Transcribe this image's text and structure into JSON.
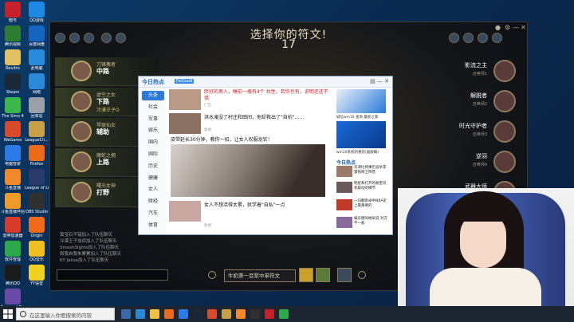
{
  "desktop_icons": [
    {
      "label": "暗号",
      "color": "#c8202a"
    },
    {
      "label": "QQ游戏",
      "color": "#1e88e5"
    },
    {
      "label": "腾讯视频",
      "color": "#2e7d32"
    },
    {
      "label": "百度网盘",
      "color": "#1565c0"
    },
    {
      "label": "Revitro",
      "color": "#e0c060"
    },
    {
      "label": "此电脑",
      "color": "#2a8ad8"
    },
    {
      "label": "Steam",
      "color": "#1b2838"
    },
    {
      "label": "网络",
      "color": "#2a8ad8"
    },
    {
      "label": "The Sims 4",
      "color": "#3ab84a"
    },
    {
      "label": "回收站",
      "color": "#9aa0a8"
    },
    {
      "label": "WeGame",
      "color": "#d84a2a"
    },
    {
      "label": "LeagueCli...",
      "color": "#c8a04a"
    },
    {
      "label": "电脑管家",
      "color": "#2a7ae8"
    },
    {
      "label": "Firefox",
      "color": "#e86a1a"
    },
    {
      "label": "斗鱼直播",
      "color": "#f08a2a"
    },
    {
      "label": "League of Legends",
      "color": "#2a3a6a"
    },
    {
      "label": "斗鱼直播伴侣",
      "color": "#f09a2a"
    },
    {
      "label": "OBS Studio",
      "color": "#303030"
    },
    {
      "label": "雷神加速器",
      "color": "#d83a2a"
    },
    {
      "label": "Origin",
      "color": "#f06a1a"
    },
    {
      "label": "软件管理",
      "color": "#2aa84a"
    },
    {
      "label": "QQ音乐",
      "color": "#f0c020"
    },
    {
      "label": "腾讯QQ",
      "color": "#1a1a1a"
    },
    {
      "label": "YY语音",
      "color": "#f0d020"
    },
    {
      "label": "Funmeal Party",
      "color": "#6a4aa8"
    }
  ],
  "game": {
    "title": "选择你的符文!",
    "timer": "17",
    "left_team": [
      {
        "role": "刀锋舞者",
        "lane": "中路",
        "name": ""
      },
      {
        "role": "虚空之女",
        "lane": "下路",
        "name": "冷漠王子O"
      },
      {
        "role": "琴瑟仙女",
        "lane": "辅助",
        "name": ""
      },
      {
        "role": "魔蛇之拥",
        "lane": "上路",
        "name": ""
      },
      {
        "role": "曙光女神",
        "lane": "打野",
        "name": ""
      }
    ],
    "chat_lines": [
      "黄宝石不错加入了队伍聊天",
      "冷漠王子加佰加入了队伍聊天",
      "SmashSights加入了队伍聊天",
      "和我自我朱累累加入了队伍聊天",
      "KY Jaksa加入了队伍聊天"
    ],
    "right_team": [
      {
        "name": "影流之主",
        "sub": "召唤师1"
      },
      {
        "name": "解脱者",
        "sub": "召唤师2"
      },
      {
        "name": "时光守护者",
        "sub": "召唤师3"
      },
      {
        "name": "逆羽",
        "sub": "召唤师4"
      },
      {
        "name": "武器大师",
        "sub": "召唤师5"
      }
    ],
    "skin_select": "牛奶第一豆浆中单符文",
    "window_controls": [
      "●",
      "⚙",
      "—",
      "✕"
    ]
  },
  "popup": {
    "title": "今日热点",
    "badge": "FeiGuo8",
    "controls": "▤ — ✕",
    "categories": [
      "头条",
      "社会",
      "军事",
      "娱乐",
      "国内",
      "国际",
      "历史",
      "健康",
      "女人",
      "财经",
      "汽车",
      "体育"
    ],
    "active_category": "头条",
    "items": [
      {
        "text": "胖好的男人，睡前一瓶有4个 共性，若你也有，说明还还不错",
        "source": "广告",
        "red": true
      },
      {
        "text": "洪水淹没了村庄和田间，他却救出了\"自杭\"……",
        "source": "新闻"
      },
      {
        "text": "皮带延长30分钟，教你一招，让女人叹服龙钦！",
        "source": ""
      },
      {
        "text": "女人不想活得太累，就学着\"自私\"一点",
        "source": "新闻"
      }
    ],
    "side": {
      "ad_title": "城信win10 查询 最新之家",
      "ad2_title": "win10系统的重装(副服确)",
      "hot_title": "今日热点",
      "hot_items": [
        "天津比特事仍追杀李雷抱保卫阵营",
        "明星和打开的秘密玩机拨动的细节",
        "一归翻街卓中NBA史上最重要的",
        "娱乐圈叫她早说 对方不一般"
      ]
    }
  },
  "taskbar": {
    "search_placeholder": "在这里输入你要搜索的内容"
  }
}
